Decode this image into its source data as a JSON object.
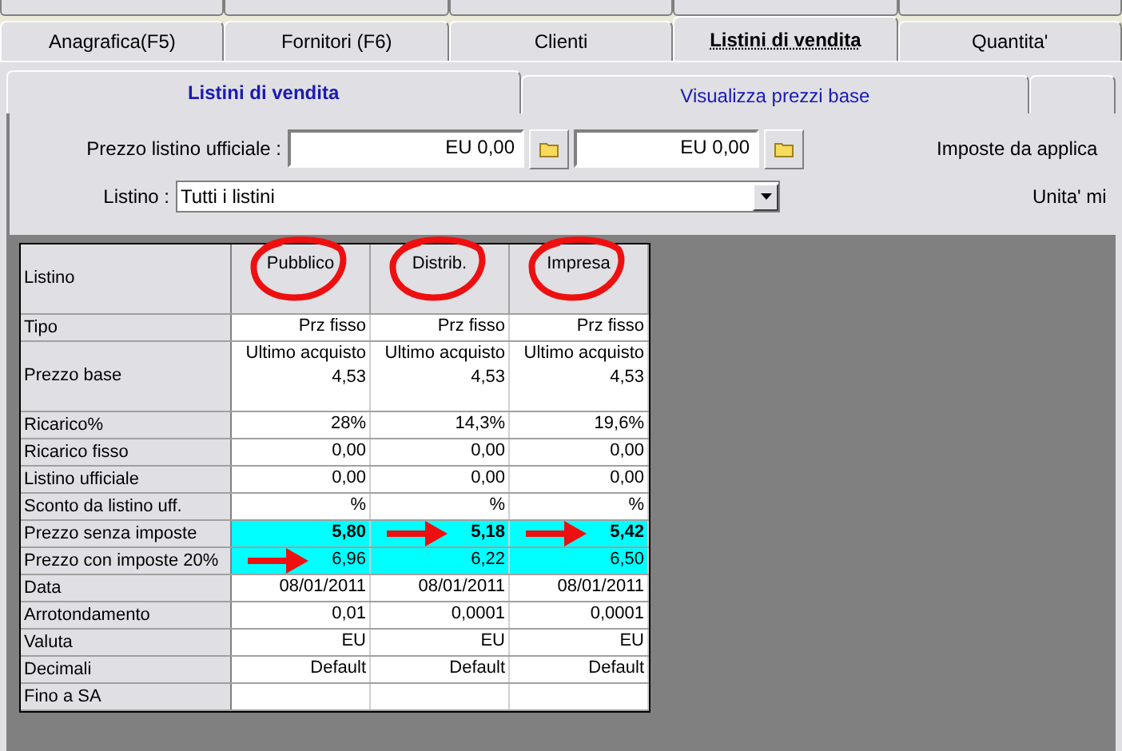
{
  "top_tabs": [
    {
      "selected": false
    },
    {
      "selected": false
    },
    {
      "selected": false
    },
    {
      "selected": false
    },
    {
      "selected": false
    }
  ],
  "tabs": [
    {
      "label": "Anagrafica(F5)",
      "selected": false
    },
    {
      "label": "Fornitori (F6)",
      "selected": false
    },
    {
      "label": "Clienti",
      "selected": false
    },
    {
      "label": "Listini di vendita",
      "selected": true
    },
    {
      "label": "Quantita'",
      "selected": false
    }
  ],
  "sub_tabs": [
    {
      "label": "Listini di vendita",
      "selected": true
    },
    {
      "label": "Visualizza prezzi base",
      "selected": false
    },
    {
      "selected": false
    }
  ],
  "form": {
    "official_price_label": "Prezzo listino ufficiale :",
    "official_price_1": "EU 0,00",
    "official_price_2": "EU 0,00",
    "listino_label": "Listino :",
    "listino_value": "Tutti i listini",
    "right_label_1": "Imposte da applica",
    "right_label_2": "Unita' mi"
  },
  "grid": {
    "header_label": "Listino",
    "columns": [
      {
        "name": "Pubblico",
        "circled": true
      },
      {
        "name": "Distrib.",
        "circled": true
      },
      {
        "name": "Impresa",
        "circled": true
      }
    ],
    "rows": [
      {
        "label": "Tipo",
        "values": [
          "Prz fisso",
          "Prz fisso",
          "Prz fisso"
        ],
        "highlighted": false,
        "bold": false,
        "arrows": [
          false,
          false,
          false
        ]
      },
      {
        "label": "Prezzo base",
        "values": [
          "Ultimo acquisto\n4,53",
          "Ultimo acquisto\n4,53",
          "Ultimo acquisto\n4,53"
        ],
        "highlighted": false,
        "bold": false,
        "arrows": [
          false,
          false,
          false
        ]
      },
      {
        "label": "Ricarico%",
        "values": [
          "28%",
          "14,3%",
          "19,6%"
        ],
        "highlighted": false,
        "bold": false,
        "arrows": [
          false,
          false,
          false
        ]
      },
      {
        "label": "Ricarico fisso",
        "values": [
          "0,00",
          "0,00",
          "0,00"
        ],
        "highlighted": false,
        "bold": false,
        "arrows": [
          false,
          false,
          false
        ]
      },
      {
        "label": "Listino ufficiale",
        "values": [
          "0,00",
          "0,00",
          "0,00"
        ],
        "highlighted": false,
        "bold": false,
        "arrows": [
          false,
          false,
          false
        ]
      },
      {
        "label": "Sconto da listino uff.",
        "values": [
          "%",
          "%",
          "%"
        ],
        "highlighted": false,
        "bold": false,
        "arrows": [
          false,
          false,
          false
        ]
      },
      {
        "label": "Prezzo senza imposte",
        "values": [
          "5,80",
          "5,18",
          "5,42"
        ],
        "highlighted": true,
        "bold": true,
        "arrows": [
          false,
          true,
          true
        ]
      },
      {
        "label": "Prezzo con imposte 20%",
        "values": [
          "6,96",
          "6,22",
          "6,50"
        ],
        "highlighted": true,
        "bold": false,
        "arrows": [
          true,
          false,
          false
        ]
      },
      {
        "label": "Data",
        "values": [
          "08/01/2011",
          "08/01/2011",
          "08/01/2011"
        ],
        "highlighted": false,
        "bold": false,
        "arrows": [
          false,
          false,
          false
        ]
      },
      {
        "label": "Arrotondamento",
        "values": [
          "0,01",
          "0,0001",
          "0,0001"
        ],
        "highlighted": false,
        "bold": false,
        "arrows": [
          false,
          false,
          false
        ]
      },
      {
        "label": "Valuta",
        "values": [
          "EU",
          "EU",
          "EU"
        ],
        "highlighted": false,
        "bold": false,
        "arrows": [
          false,
          false,
          false
        ]
      },
      {
        "label": "Decimali",
        "values": [
          "Default",
          "Default",
          "Default"
        ],
        "highlighted": false,
        "bold": false,
        "arrows": [
          false,
          false,
          false
        ]
      },
      {
        "label": "Fino a SA",
        "highlighted": false,
        "arrows": [
          false,
          false,
          false
        ]
      }
    ]
  }
}
